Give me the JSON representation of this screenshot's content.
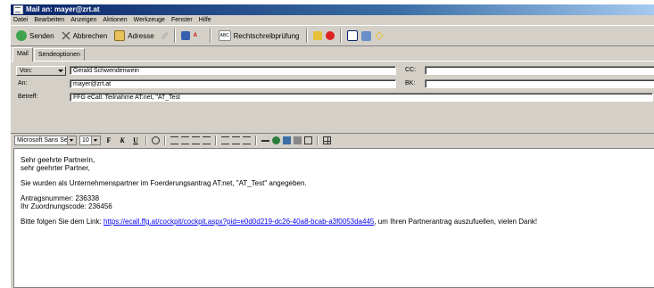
{
  "window": {
    "title": "Mail an: mayer@zrt.at"
  },
  "menu": [
    "Datei",
    "Bearbeiten",
    "Anzeigen",
    "Aktionen",
    "Werkzeuge",
    "Fenster",
    "Hilfe"
  ],
  "toolbar": {
    "send": "Senden",
    "cancel": "Abbrechen",
    "address": "Adresse",
    "spellcheck": "Rechtschreibprüfung"
  },
  "tabs": [
    "Mail",
    "Sendeoptionen"
  ],
  "fields": {
    "from_label": "Von:",
    "from_value": "Gerald Schwendenwein",
    "to_label": "An:",
    "to_value": "mayer@zrt.at",
    "subject_label": "Betreff:",
    "subject_value": "FFG eCall: Teilnahme AT:net, \"AT_Test",
    "cc_label": "CC:",
    "bk_label": "BK:"
  },
  "format": {
    "font": "Microsoft Sans Serif",
    "size": "10",
    "bold": "F",
    "italic": "K",
    "underline": "U"
  },
  "body": {
    "greeting1": "Sehr geehrte Partnerin,",
    "greeting2": "sehr geehrter Partner,",
    "line1": "Sie wurden als Unternehmenspartner im Foerderungsantrag AT:net, \"AT_Test\" angegeben.",
    "antrag": "Antragsnummer: 236338",
    "code": "Ihr Zuordnungscode: 236456",
    "link_pre": "Bitte folgen Sie dem Link: ",
    "link": "https://ecall.ffg.at/cockpit/cockpit.aspx?pid=e0d0d219-dc26-40a8-bcab-a3f0053da445",
    "link_post": ", um Ihren Partnerantrag auszufuellen, vielen Dank!"
  }
}
